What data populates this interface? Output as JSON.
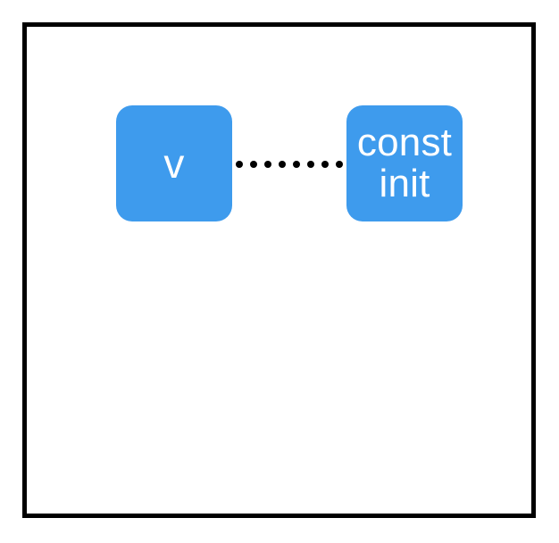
{
  "nodes": {
    "v": {
      "label": "v",
      "color": "#3e9bed",
      "textColor": "#ffffff"
    },
    "constinit": {
      "label": "const\ninit",
      "color": "#3e9bed",
      "textColor": "#ffffff"
    }
  },
  "edges": {
    "v_to_constinit": {
      "style": "dotted",
      "color": "#000000",
      "dotCount": 8
    }
  }
}
